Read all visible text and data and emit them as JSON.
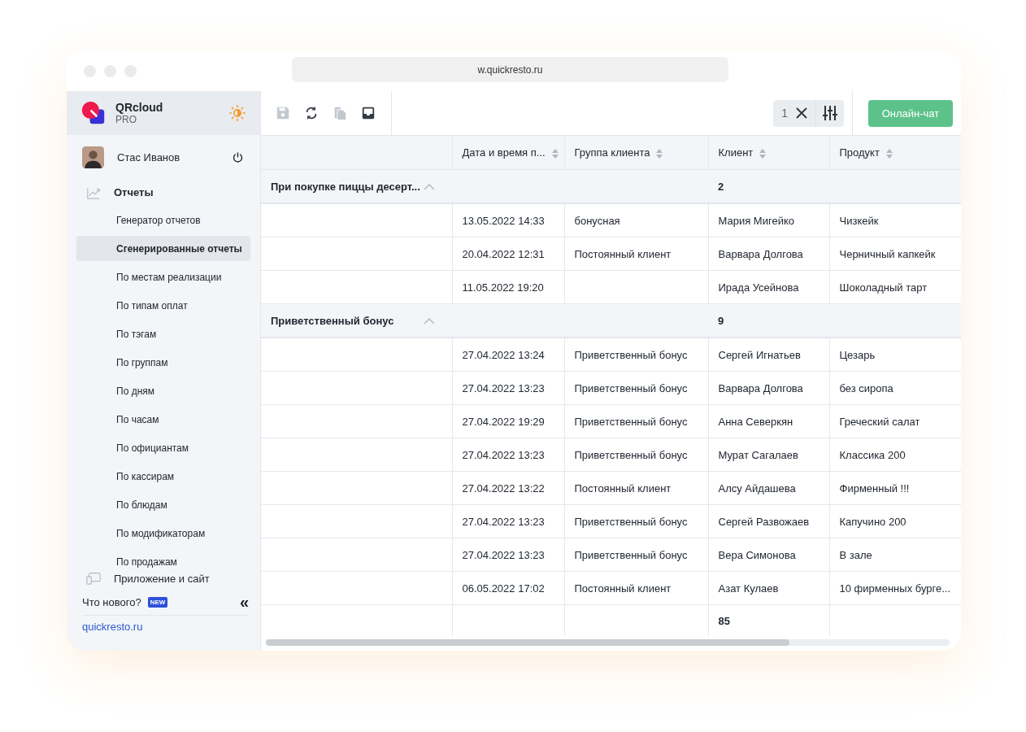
{
  "browser": {
    "url": "w.quickresto.ru"
  },
  "sidebar": {
    "brand": {
      "name": "QRcloud",
      "plan": "PRO"
    },
    "user": {
      "name": "Стас Иванов"
    },
    "nav": [
      {
        "kind": "reports",
        "label": "Отчеты",
        "expanded": true,
        "children": [
          {
            "label": "Генератор отчетов",
            "selected": false
          },
          {
            "label": "Сгенерированные отчеты",
            "selected": true
          },
          {
            "label": "По местам реализации",
            "selected": false
          },
          {
            "label": "По типам оплат",
            "selected": false
          },
          {
            "label": "По тэгам",
            "selected": false
          },
          {
            "label": "По группам",
            "selected": false
          },
          {
            "label": "По дням",
            "selected": false
          },
          {
            "label": "По часам",
            "selected": false
          },
          {
            "label": "По официантам",
            "selected": false
          },
          {
            "label": "По кассирам",
            "selected": false
          },
          {
            "label": "По блюдам",
            "selected": false
          },
          {
            "label": "По модификаторам",
            "selected": false
          },
          {
            "label": "По продажам",
            "selected": false
          }
        ]
      },
      {
        "kind": "app",
        "label": "Приложение и сайт",
        "expanded": false
      }
    ],
    "whats_new": "Что нового?",
    "badge": "NEW",
    "collapse": "«",
    "link": "quickresto.ru"
  },
  "toolbar": {
    "tools": [
      {
        "kind": "save",
        "disabled": true
      },
      {
        "kind": "refresh",
        "disabled": false
      },
      {
        "kind": "copy",
        "disabled": true
      },
      {
        "kind": "inbox",
        "disabled": false
      }
    ],
    "filter_count": "1",
    "chat_button": "Онлайн-чат"
  },
  "table": {
    "columns": [
      {
        "label": "Дата и время п..."
      },
      {
        "label": "Группа клиента"
      },
      {
        "label": "Клиент"
      },
      {
        "label": "Продукт"
      }
    ],
    "groups": [
      {
        "label": "При покупке пиццы десерт...",
        "expanded": true,
        "count": "2",
        "rows": [
          [
            "13.05.2022 14:33",
            "бонусная",
            "Мария Мигейко",
            "Чизкейк"
          ],
          [
            "20.04.2022 12:31",
            "Постоянный клиент",
            "Варвара Долгова",
            "Черничный капкейк"
          ],
          [
            "11.05.2022 19:20",
            "",
            "Ирада Усейнова",
            "Шоколадный тарт"
          ]
        ]
      },
      {
        "label": "Приветственный бонус",
        "expanded": true,
        "count": "9",
        "rows": [
          [
            "27.04.2022 13:24",
            "Приветственный бонус",
            "Сергей Игнатьев",
            "Цезарь"
          ],
          [
            "27.04.2022 13:23",
            "Приветственный бонус",
            "Варвара Долгова",
            "без сиропа"
          ],
          [
            "27.04.2022 19:29",
            "Приветственный бонус",
            "Анна Северкян",
            "Греческий салат"
          ],
          [
            "27.04.2022 13:23",
            "Приветственный бонус",
            "Мурат Сагалаев",
            "Классика 200"
          ],
          [
            "27.04.2022 13:22",
            "Постоянный клиент",
            "Алсу Айдашева",
            "Фирменный !!!"
          ],
          [
            "27.04.2022 13:23",
            "Приветственный бонус",
            "Сергей Развожаев",
            "Капучино 200"
          ],
          [
            "27.04.2022 13:23",
            "Приветственный бонус",
            "Вера Симонова",
            "В зале"
          ],
          [
            "06.05.2022 17:02",
            "Постоянный клиент",
            "Азат Кулаев",
            "10 фирменных бурге..."
          ]
        ]
      }
    ],
    "total": "85"
  }
}
